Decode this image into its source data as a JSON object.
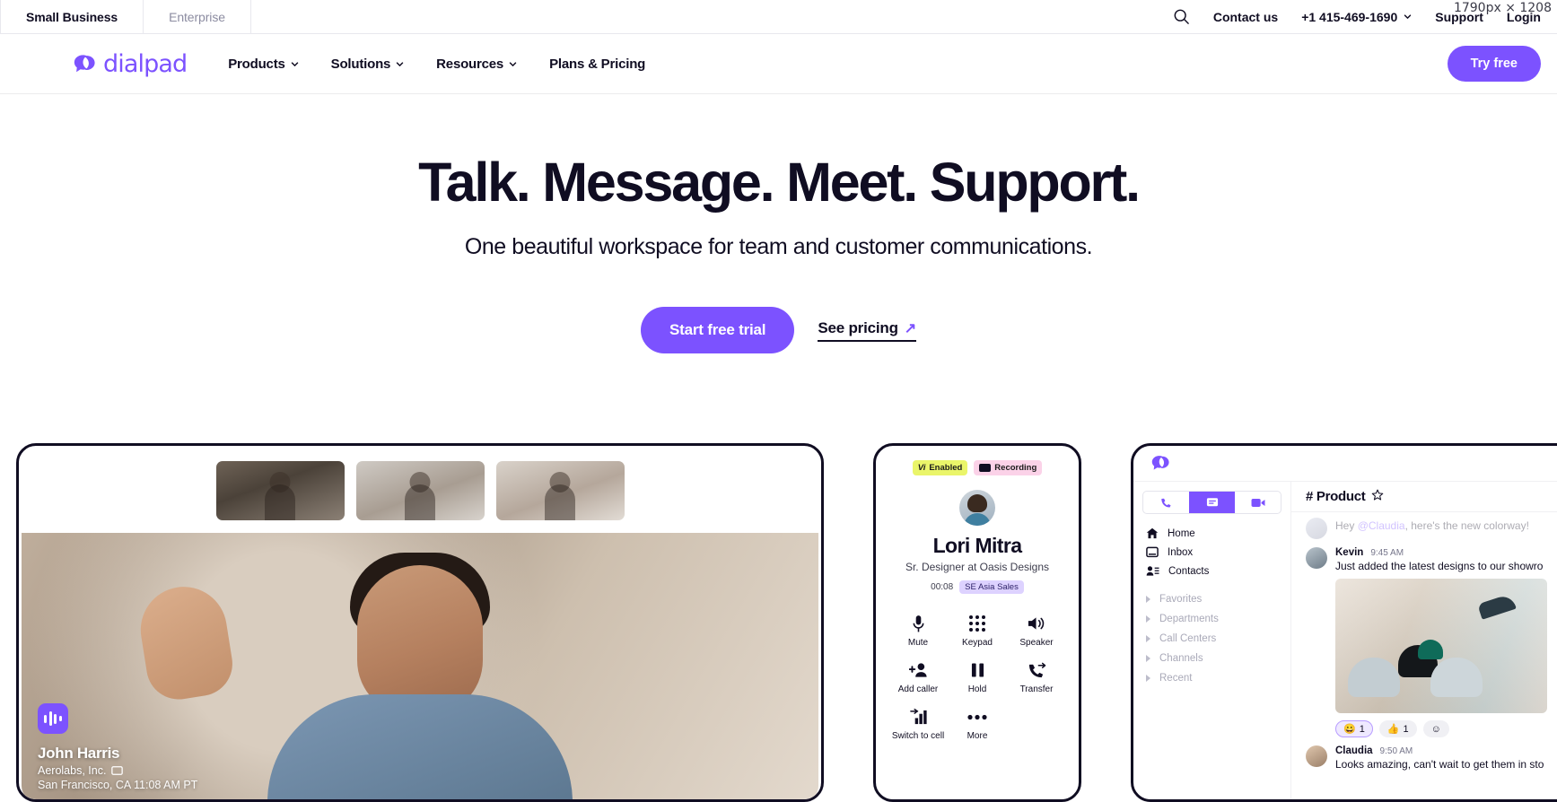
{
  "viewport_badge": "1790px × 1208",
  "utility": {
    "segments": [
      {
        "label": "Small Business",
        "active": true
      },
      {
        "label": "Enterprise",
        "active": false
      }
    ],
    "search_icon": "search-icon",
    "links": [
      {
        "label": "Contact us"
      },
      {
        "label": "Support"
      },
      {
        "label": "Login"
      }
    ],
    "phone": "+1 415-469-1690"
  },
  "nav": {
    "logo_text": "dialpad",
    "items": [
      {
        "label": "Products",
        "has_menu": true
      },
      {
        "label": "Solutions",
        "has_menu": true
      },
      {
        "label": "Resources",
        "has_menu": true
      },
      {
        "label": "Plans & Pricing",
        "has_menu": false
      }
    ],
    "cta": "Try free"
  },
  "hero": {
    "headline": "Talk. Message. Meet. Support.",
    "subhead": "One beautiful workspace for team and customer communications.",
    "primary_cta": "Start free trial",
    "secondary_cta": "See pricing",
    "secondary_icon": "arrow-up-right-icon"
  },
  "video_card": {
    "caller_name": "John Harris",
    "caller_org": "Aerolabs, Inc.",
    "caller_location": "San Francisco, CA  11:08 AM PT",
    "thumbnails": [
      "participant-1",
      "participant-2",
      "participant-3"
    ]
  },
  "phone_card": {
    "badges": [
      {
        "mark": "Vi",
        "label": "Enabled"
      },
      {
        "mark": "rec",
        "label": "Recording"
      }
    ],
    "name": "Lori Mitra",
    "role": "Sr. Designer at Oasis Designs",
    "timer": "00:08",
    "group_tag": "SE Asia Sales",
    "controls": [
      {
        "label": "Mute",
        "icon": "microphone-icon"
      },
      {
        "label": "Keypad",
        "icon": "keypad-icon"
      },
      {
        "label": "Speaker",
        "icon": "speaker-icon"
      },
      {
        "label": "Add caller",
        "icon": "add-person-icon"
      },
      {
        "label": "Hold",
        "icon": "pause-icon"
      },
      {
        "label": "Transfer",
        "icon": "call-transfer-icon"
      },
      {
        "label": "Switch to cell",
        "icon": "switch-device-icon"
      },
      {
        "label": "More",
        "icon": "more-horizontal-icon"
      }
    ]
  },
  "app_card": {
    "mode_tabs": [
      {
        "icon": "phone-icon",
        "active": false
      },
      {
        "icon": "message-icon",
        "active": true
      },
      {
        "icon": "video-icon",
        "active": false
      }
    ],
    "nav_items": [
      {
        "label": "Home",
        "icon": "home-icon"
      },
      {
        "label": "Inbox",
        "icon": "inbox-icon"
      },
      {
        "label": "Contacts",
        "icon": "contacts-icon"
      }
    ],
    "groups": [
      {
        "label": "Favorites"
      },
      {
        "label": "Departments"
      },
      {
        "label": "Call Centers"
      },
      {
        "label": "Channels"
      },
      {
        "label": "Recent"
      }
    ],
    "channel_title": "# Product",
    "star_icon": "star-outline-icon",
    "messages": [
      {
        "author": "",
        "time": "",
        "mention": "@Claudia",
        "text_before": "Hey ",
        "text_after": ", here's the new colorway!",
        "faded": true
      },
      {
        "author": "Kevin",
        "time": "9:45 AM",
        "text": "Just added the latest designs to our showro",
        "has_photo": true
      },
      {
        "author": "Claudia",
        "time": "9:50 AM",
        "text": "Looks amazing, can't wait to get them in sto"
      }
    ],
    "reactions": [
      {
        "emoji": "😀",
        "count": "1",
        "selected": true
      },
      {
        "emoji": "👍",
        "count": "1",
        "selected": false
      },
      {
        "emoji": "☺",
        "count": "",
        "selected": false
      }
    ]
  },
  "colors": {
    "brand_purple": "#7c52ff",
    "ink": "#100d22",
    "badge_yellow": "#eaf56a",
    "badge_pink": "#fbd2e8",
    "tag_lavender": "#ddd2ff"
  }
}
